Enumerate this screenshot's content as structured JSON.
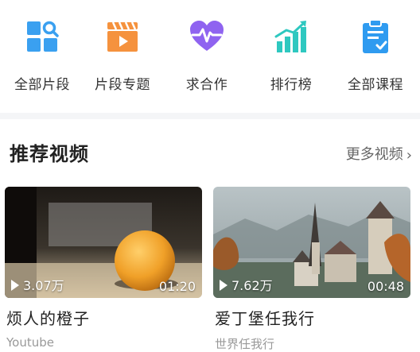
{
  "nav": [
    {
      "label": "全部片段",
      "icon": "grid-search-icon",
      "color": "#3aa0f0"
    },
    {
      "label": "片段专题",
      "icon": "clapperboard-icon",
      "color": "#f5923e"
    },
    {
      "label": "求合作",
      "icon": "heartbeat-icon",
      "color": "#8f63f0"
    },
    {
      "label": "排行榜",
      "icon": "bar-chart-icon",
      "color": "#2ec8c0"
    },
    {
      "label": "全部课程",
      "icon": "clipboard-check-icon",
      "color": "#2f9bf0"
    }
  ],
  "section": {
    "title": "推荐视频",
    "more": "更多视频",
    "more_icon": "chevron-right-icon"
  },
  "videos": [
    {
      "title": "烦人的橙子",
      "views": "3.07万",
      "duration": "01:20",
      "source": "Youtube"
    },
    {
      "title": "爱丁堡任我行",
      "views": "7.62万",
      "duration": "00:48",
      "source": "世界任我行"
    }
  ]
}
